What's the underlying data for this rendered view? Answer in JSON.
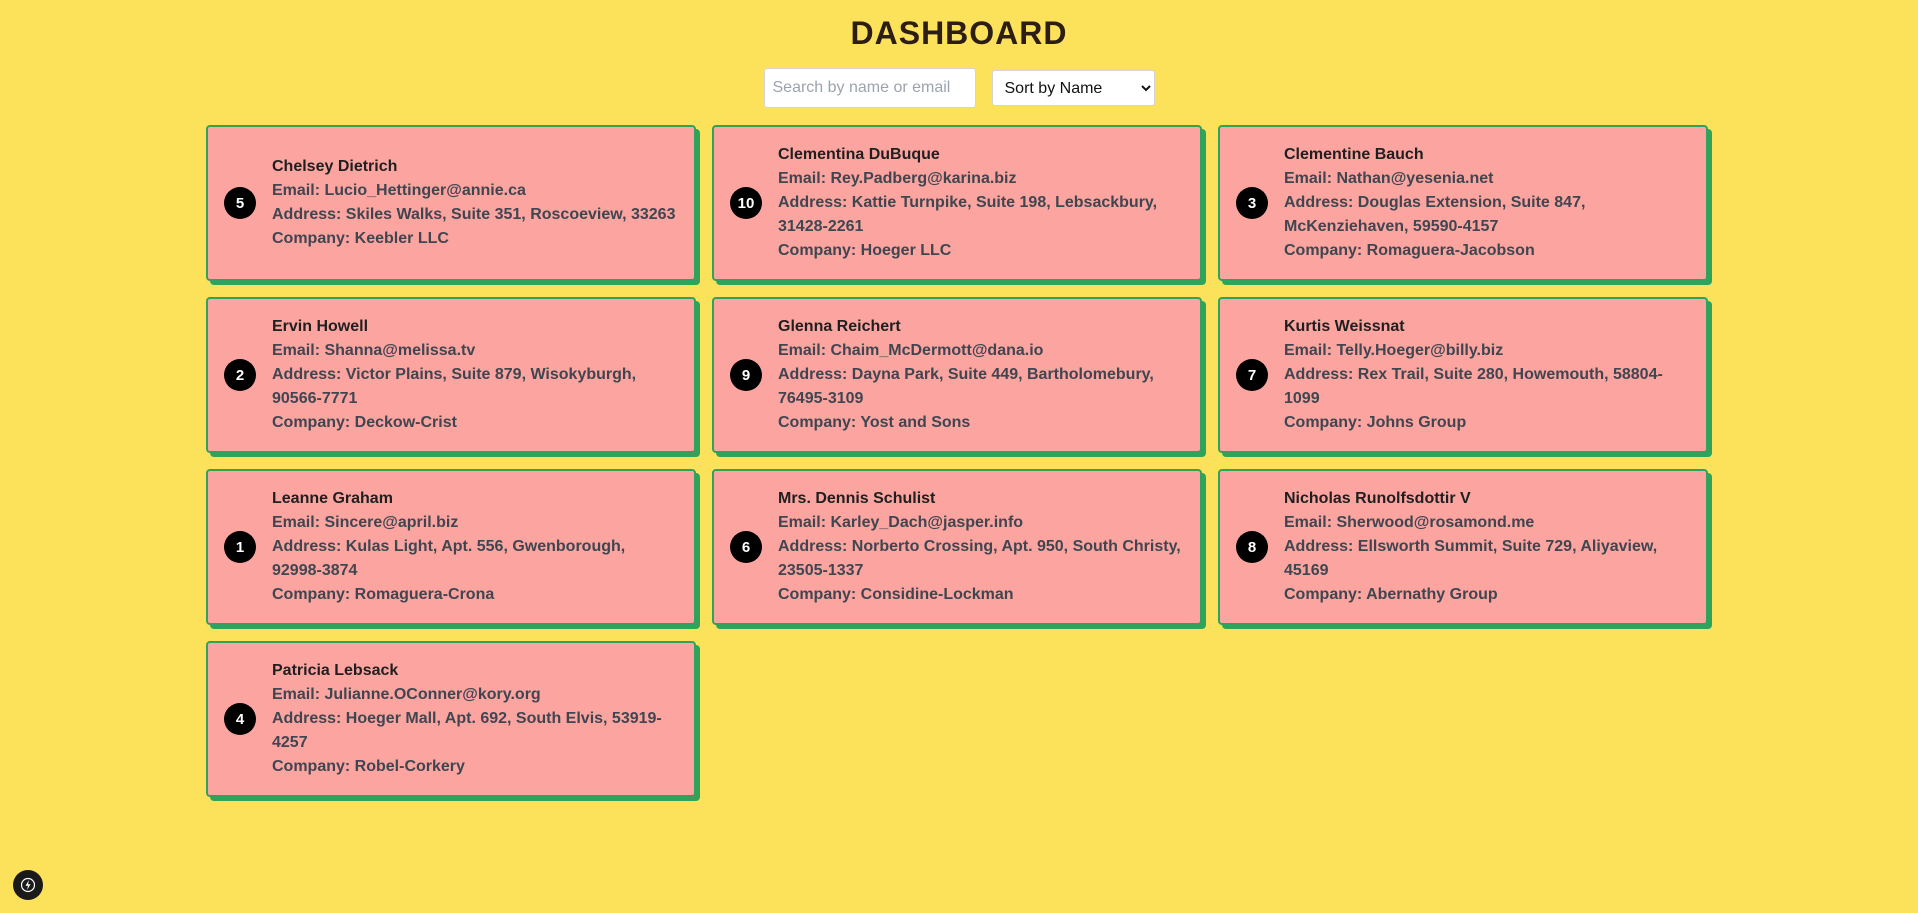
{
  "header": {
    "title": "DASHBOARD"
  },
  "controls": {
    "search_placeholder": "Search by name or email",
    "search_value": "",
    "sort_selected": "Sort by Name"
  },
  "labels": {
    "email": "Email: ",
    "address": "Address: ",
    "company": "Company: "
  },
  "users": [
    {
      "id": "5",
      "name": "Chelsey Dietrich",
      "email": "Lucio_Hettinger@annie.ca",
      "address": "Skiles Walks, Suite 351, Roscoeview, 33263",
      "company": "Keebler LLC"
    },
    {
      "id": "10",
      "name": "Clementina DuBuque",
      "email": "Rey.Padberg@karina.biz",
      "address": "Kattie Turnpike, Suite 198, Lebsackbury, 31428-2261",
      "company": "Hoeger LLC"
    },
    {
      "id": "3",
      "name": "Clementine Bauch",
      "email": "Nathan@yesenia.net",
      "address": "Douglas Extension, Suite 847, McKenziehaven, 59590-4157",
      "company": "Romaguera-Jacobson"
    },
    {
      "id": "2",
      "name": "Ervin Howell",
      "email": "Shanna@melissa.tv",
      "address": "Victor Plains, Suite 879, Wisokyburgh, 90566-7771",
      "company": "Deckow-Crist"
    },
    {
      "id": "9",
      "name": "Glenna Reichert",
      "email": "Chaim_McDermott@dana.io",
      "address": "Dayna Park, Suite 449, Bartholomebury, 76495-3109",
      "company": "Yost and Sons"
    },
    {
      "id": "7",
      "name": "Kurtis Weissnat",
      "email": "Telly.Hoeger@billy.biz",
      "address": "Rex Trail, Suite 280, Howemouth, 58804-1099",
      "company": "Johns Group"
    },
    {
      "id": "1",
      "name": "Leanne Graham",
      "email": "Sincere@april.biz",
      "address": "Kulas Light, Apt. 556, Gwenborough, 92998-3874",
      "company": "Romaguera-Crona"
    },
    {
      "id": "6",
      "name": "Mrs. Dennis Schulist",
      "email": "Karley_Dach@jasper.info",
      "address": "Norberto Crossing, Apt. 950, South Christy, 23505-1337",
      "company": "Considine-Lockman"
    },
    {
      "id": "8",
      "name": "Nicholas Runolfsdottir V",
      "email": "Sherwood@rosamond.me",
      "address": "Ellsworth Summit, Suite 729, Aliyaview, 45169",
      "company": "Abernathy Group"
    },
    {
      "id": "4",
      "name": "Patricia Lebsack",
      "email": "Julianne.OConner@kory.org",
      "address": "Hoeger Mall, Apt. 692, South Elvis, 53919-4257",
      "company": "Robel-Corkery"
    }
  ],
  "devtools": {
    "icon": "lightning-icon"
  },
  "colors": {
    "background": "#fce15a",
    "card": "#fca5a0",
    "card_border": "#2fa35b",
    "badge": "#000000"
  }
}
